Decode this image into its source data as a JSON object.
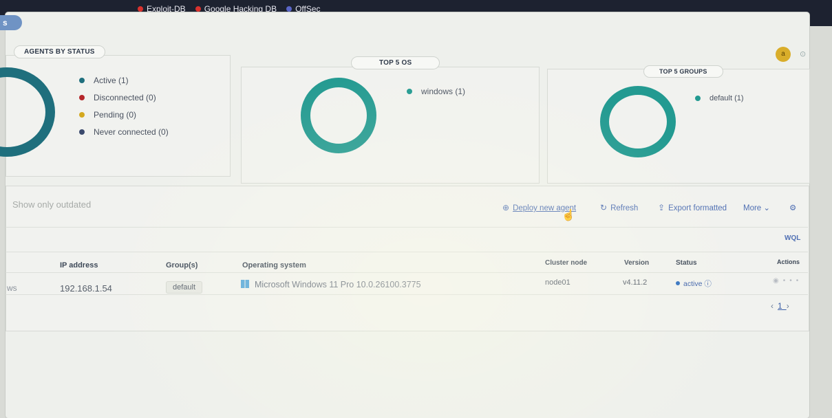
{
  "browser": {
    "bookmarks": [
      "Exploit-DB",
      "Google Hacking DB",
      "OffSec"
    ],
    "icons": [
      "star-icon",
      "pocket-icon",
      "download-icon",
      "account-icon",
      "home-icon",
      "menu-icon"
    ]
  },
  "app": {
    "tab_label": "s",
    "avatar_letter": "a"
  },
  "agents_by_status": {
    "title": "AGENTS BY STATUS",
    "legend": [
      {
        "label": "Active (1)",
        "color": "#1f6f7d"
      },
      {
        "label": "Disconnected (0)",
        "color": "#b5262a"
      },
      {
        "label": "Pending (0)",
        "color": "#d4a81e"
      },
      {
        "label": "Never connected (0)",
        "color": "#3b4a6d"
      }
    ]
  },
  "top_os": {
    "title": "TOP 5 OS",
    "legend": [
      {
        "label": "windows (1)",
        "color": "#239a91"
      }
    ]
  },
  "top_groups": {
    "title": "TOP 5 GROUPS",
    "legend": [
      {
        "label": "default (1)",
        "color": "#239a91"
      }
    ]
  },
  "toolbar": {
    "search_placeholder": "Show only outdated",
    "deploy": "Deploy new agent",
    "refresh": "Refresh",
    "export": "Export formatted",
    "more": "More",
    "wql": "WQL"
  },
  "table": {
    "headers": {
      "ip": "IP address",
      "groups": "Group(s)",
      "os": "Operating system",
      "node": "Cluster node",
      "version": "Version",
      "status": "Status",
      "actions": "Actions"
    },
    "rows": [
      {
        "name": "ws",
        "ip": "192.168.1.54",
        "group": "default",
        "os": "Microsoft Windows 11 Pro 10.0.26100.3775",
        "node": "node01",
        "version": "v4.11.2",
        "status": "active"
      }
    ]
  },
  "pagination": {
    "current": "1"
  }
}
